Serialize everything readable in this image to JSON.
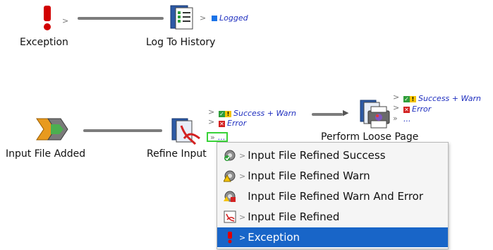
{
  "canvas": {
    "nodes": [
      {
        "label": "Exception",
        "icon": "exclamation-icon"
      },
      {
        "label": "Log To History",
        "icon": "log-history-icon",
        "outputs": [
          "Logged"
        ]
      },
      {
        "label": "Input File Added",
        "icon": "input-file-added-icon"
      },
      {
        "label": "Refine Input",
        "icon": "refine-input-icon",
        "outputs": [
          "Success + Warn",
          "Error",
          "..."
        ]
      },
      {
        "label": "Perform Loose Page",
        "icon": "perform-loose-page-icon",
        "outputs": [
          "Success + Warn",
          "Error",
          "..."
        ]
      }
    ]
  },
  "context_menu": {
    "items": [
      {
        "label": "Input File Refined Success",
        "icon": "refined-success-icon",
        "selected": false
      },
      {
        "label": "Input File Refined Warn",
        "icon": "refined-warn-icon",
        "selected": false
      },
      {
        "label": "Input File Refined Warn And Error",
        "icon": "refined-warn-error-icon",
        "selected": false
      },
      {
        "label": "Input File Refined",
        "icon": "refined-pdf-icon",
        "selected": false
      },
      {
        "label": "Exception",
        "icon": "exclamation-icon",
        "selected": true
      }
    ]
  },
  "colors": {
    "connector": "#7c7c7c",
    "output_label": "#1f2fbf",
    "selection": "#1865c8",
    "highlight_box": "#39d339"
  }
}
